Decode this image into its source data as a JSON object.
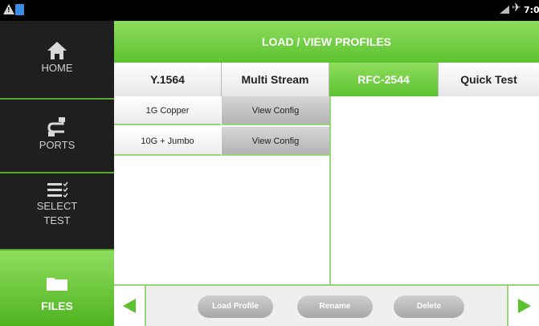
{
  "statusbar": {
    "warning_glyph": "!",
    "time": "7:0",
    "icons": [
      "warning-icon",
      "sd-card-icon",
      "signal-icon",
      "airplane-icon"
    ]
  },
  "sidebar": {
    "items": [
      {
        "label": "HOME",
        "icon": "home-icon"
      },
      {
        "label": "PORTS",
        "icon": "ports-icon"
      },
      {
        "label": "SELECT\nTEST",
        "icon": "select-test-icon"
      },
      {
        "label": "FILES",
        "icon": "folder-icon",
        "active": true
      }
    ]
  },
  "header": {
    "title": "LOAD / VIEW PROFILES"
  },
  "tabs": [
    {
      "label": "Y.1564"
    },
    {
      "label": "Multi Stream"
    },
    {
      "label": "RFC-2544",
      "active": true
    },
    {
      "label": "Quick Test"
    }
  ],
  "profiles": [
    {
      "name": "1G Copper",
      "action": "View Config"
    },
    {
      "name": "10G + Jumbo",
      "action": "View Config"
    }
  ],
  "actions": {
    "load": "Load Profile",
    "rename": "Rename",
    "delete": "Delete"
  },
  "colors": {
    "accent": "#5cc22f",
    "sidebar_bg": "#1f1f1f",
    "button_gray": "#b3b3b3"
  }
}
